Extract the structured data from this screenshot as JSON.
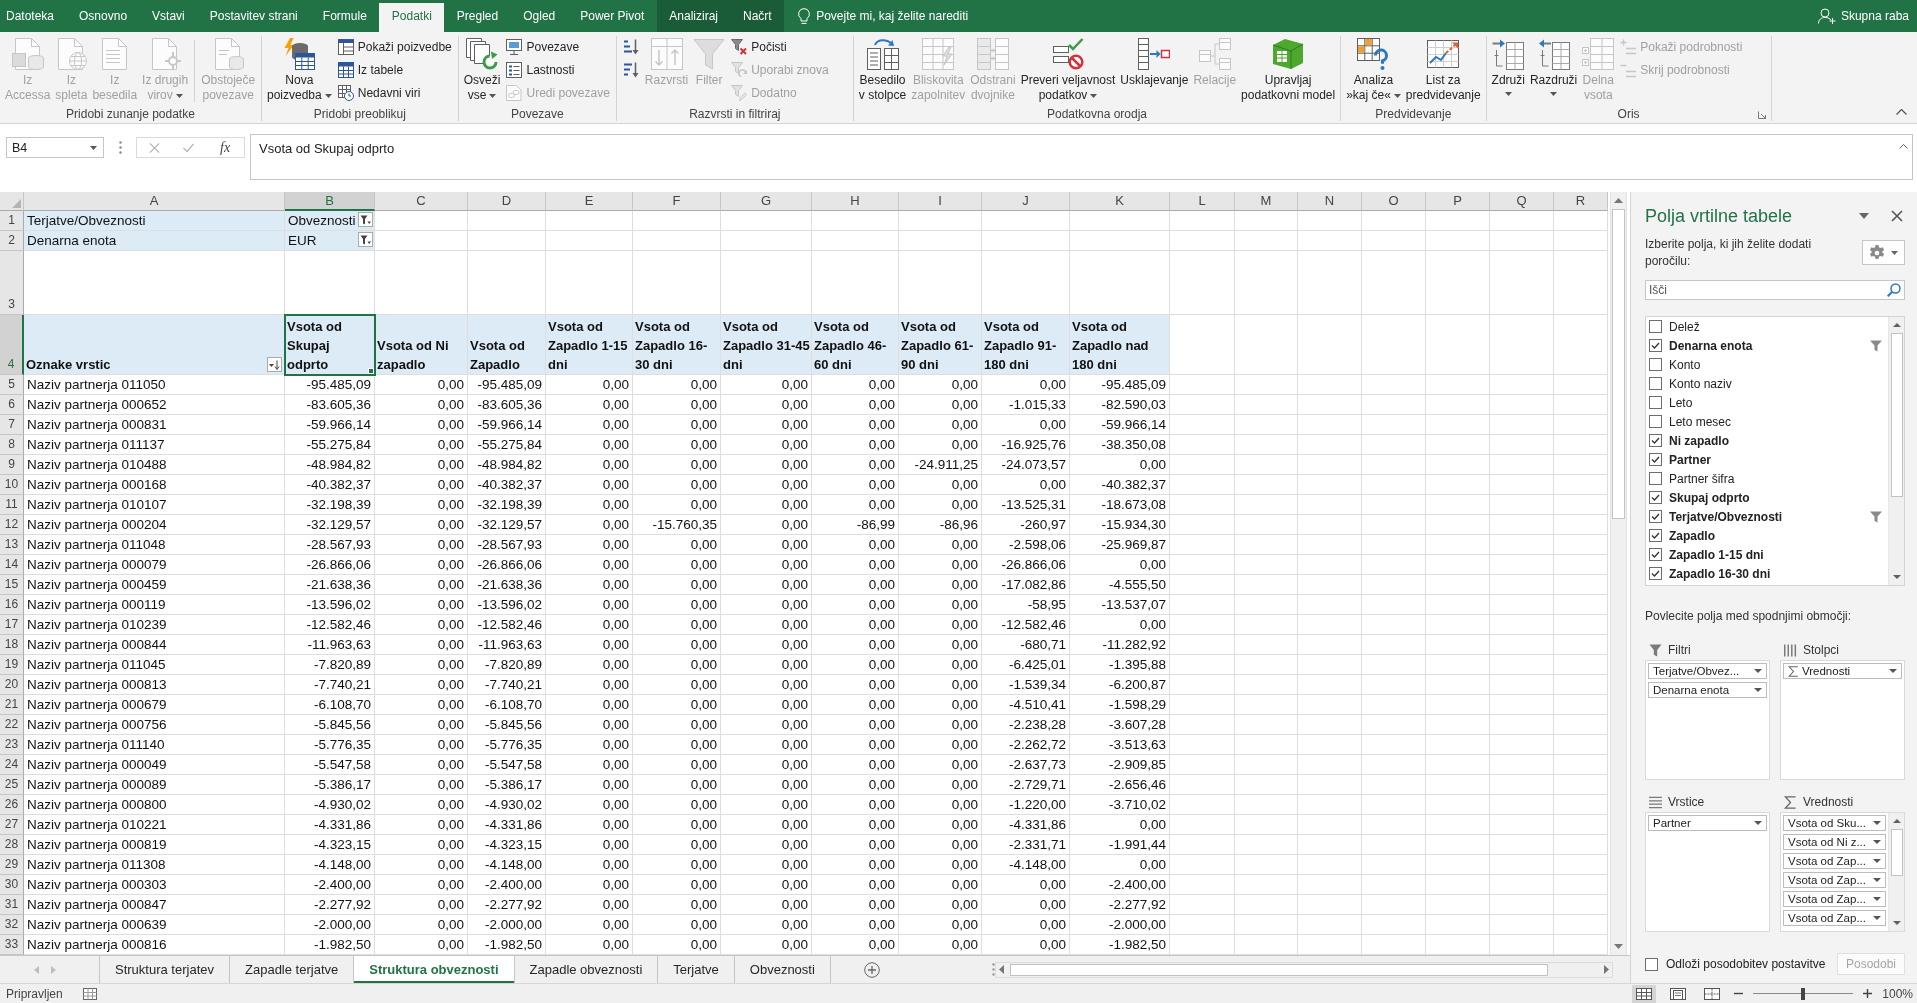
{
  "ribbon_tabs": [
    {
      "label": "Datoteka",
      "kind": "normal",
      "selected": false
    },
    {
      "label": "Osnovno",
      "kind": "normal",
      "selected": false
    },
    {
      "label": "Vstavi",
      "kind": "normal",
      "selected": false
    },
    {
      "label": "Postavitev strani",
      "kind": "normal",
      "selected": false
    },
    {
      "label": "Formule",
      "kind": "normal",
      "selected": false
    },
    {
      "label": "Podatki",
      "kind": "normal",
      "selected": true
    },
    {
      "label": "Pregled",
      "kind": "normal",
      "selected": false
    },
    {
      "label": "Ogled",
      "kind": "normal",
      "selected": false
    },
    {
      "label": "Power Pivot",
      "kind": "normal",
      "selected": false
    },
    {
      "label": "Analiziraj",
      "kind": "contextual",
      "selected": false
    },
    {
      "label": "Načrt",
      "kind": "contextual",
      "selected": false
    }
  ],
  "tell_me": {
    "placeholder": "Povejte mi, kaj želite narediti"
  },
  "share": "Skupna raba",
  "ribbon": {
    "groups": [
      {
        "label": "Pridobi zunanje podatke",
        "items": [
          {
            "kind": "large",
            "label": "Iz\nAccessa",
            "disabled": true,
            "dropdown": false
          },
          {
            "kind": "large",
            "label": "Iz\nspleta",
            "disabled": true,
            "dropdown": false
          },
          {
            "kind": "large",
            "label": "Iz\nbesedila",
            "disabled": true,
            "dropdown": false
          },
          {
            "kind": "large",
            "label": "Iz drugih\nvirov",
            "disabled": true,
            "dropdown": true
          },
          {
            "kind": "large",
            "label": "Obstoječe\npovezave",
            "disabled": true,
            "dropdown": false
          }
        ]
      },
      {
        "label": "Pridobi preoblikuj",
        "items": [
          {
            "kind": "large",
            "label": "Nova\npoizvedba",
            "disabled": false,
            "dropdown": true
          },
          {
            "kind": "stack",
            "buttons": [
              {
                "label": "Pokaži poizvedbe",
                "disabled": false
              },
              {
                "label": "Iz tabele",
                "disabled": false
              },
              {
                "label": "Nedavni viri",
                "disabled": false
              }
            ]
          }
        ]
      },
      {
        "label": "Povezave",
        "items": [
          {
            "kind": "large",
            "label": "Osveži\nvse",
            "disabled": false,
            "dropdown": true
          },
          {
            "kind": "stack",
            "buttons": [
              {
                "label": "Povezave",
                "disabled": false
              },
              {
                "label": "Lastnosti",
                "disabled": false
              },
              {
                "label": "Uredi povezave",
                "disabled": true
              }
            ]
          }
        ]
      },
      {
        "label": "Razvrsti in filtriraj",
        "items": [
          {
            "kind": "stack",
            "buttons": [
              {
                "disabled": false
              },
              {
                "disabled": false
              }
            ]
          },
          {
            "kind": "large",
            "label": "Razvrsti",
            "disabled": true,
            "dropdown": false
          },
          {
            "kind": "large",
            "label": "Filter",
            "disabled": true,
            "dropdown": false
          },
          {
            "kind": "stack",
            "buttons": [
              {
                "label": "Počisti",
                "disabled": false
              },
              {
                "label": "Uporabi znova",
                "disabled": true
              },
              {
                "label": "Dodatno",
                "disabled": true
              }
            ]
          }
        ]
      },
      {
        "label": "Podatkovna orodja",
        "items": [
          {
            "kind": "large",
            "label": "Besedilo\nv stolpce",
            "disabled": false,
            "dropdown": false
          },
          {
            "kind": "large",
            "label": "Bliskovita\nzapolnitev",
            "disabled": true,
            "dropdown": false
          },
          {
            "kind": "large",
            "label": "Odstrani\ndvojnike",
            "disabled": true,
            "dropdown": false
          },
          {
            "kind": "large",
            "label": "Preveri veljavnost\npodatkov",
            "disabled": false,
            "dropdown": true
          },
          {
            "kind": "large",
            "label": "Usklajevanje",
            "disabled": false,
            "dropdown": false
          },
          {
            "kind": "large",
            "label": "Relacije",
            "disabled": true,
            "dropdown": false
          },
          {
            "kind": "large",
            "label": "Upravljaj\npodatkovni model",
            "disabled": false,
            "dropdown": false
          }
        ]
      },
      {
        "label": "Predvidevanje",
        "items": [
          {
            "kind": "large",
            "label": "Analiza\n»kaj če«",
            "disabled": false,
            "dropdown": true
          },
          {
            "kind": "large",
            "label": "List za\npredvidevanje",
            "disabled": false,
            "dropdown": false
          }
        ]
      },
      {
        "label": "Oris",
        "items": [
          {
            "kind": "large",
            "label": "Združi",
            "disabled": false,
            "dropdown": true
          },
          {
            "kind": "large",
            "label": "Razdruži",
            "disabled": false,
            "dropdown": true
          },
          {
            "kind": "large",
            "label": "Delna\nvsota",
            "disabled": true,
            "dropdown": false
          },
          {
            "kind": "stack",
            "buttons": [
              {
                "label": "Pokaži podrobnosti",
                "disabled": true
              },
              {
                "label": "Skrij podrobnosti",
                "disabled": true
              }
            ]
          }
        ]
      }
    ]
  },
  "formula_bar": {
    "name_box": "B4",
    "insert_function": "fx",
    "formula": "Vsota od Skupaj odprto"
  },
  "sheet": {
    "columns": [
      {
        "label": "A",
        "selected": false
      },
      {
        "label": "B",
        "selected": true
      },
      {
        "label": "C",
        "selected": false
      },
      {
        "label": "D",
        "selected": false
      },
      {
        "label": "E",
        "selected": false
      },
      {
        "label": "F",
        "selected": false
      },
      {
        "label": "G",
        "selected": false
      },
      {
        "label": "H",
        "selected": false
      },
      {
        "label": "I",
        "selected": false
      },
      {
        "label": "J",
        "selected": false
      },
      {
        "label": "K",
        "selected": false
      },
      {
        "label": "L",
        "selected": false
      },
      {
        "label": "M",
        "selected": false
      },
      {
        "label": "N",
        "selected": false
      },
      {
        "label": "O",
        "selected": false
      },
      {
        "label": "P",
        "selected": false
      },
      {
        "label": "Q",
        "selected": false
      },
      {
        "label": "R",
        "selected": false
      }
    ],
    "rows": [
      {
        "number": "1",
        "selected": false,
        "kind": "filter",
        "label": "Terjatve/Obveznosti",
        "value": "Obveznosti"
      },
      {
        "number": "2",
        "selected": false,
        "kind": "filter",
        "label": "Denarna enota",
        "value": "EUR"
      },
      {
        "number": "3",
        "selected": false,
        "kind": "blank"
      },
      {
        "number": "4",
        "selected": true,
        "kind": "header",
        "label": "Oznake vrstic",
        "values": [
          "Vsota od\nSkupaj\nodprto",
          "Vsota od Ni\nzapadlo",
          "Vsota od\nZapadlo",
          "Vsota od\nZapadlo 1-15\ndni",
          "Vsota od\nZapadlo 16-\n30 dni",
          "Vsota od\nZapadlo 31-45\ndni",
          "Vsota od\nZapadlo 46-\n60 dni",
          "Vsota od\nZapadlo 61-\n90 dni",
          "Vsota od\nZapadlo 91-\n180 dni",
          "Vsota od\nZapadlo nad\n180 dni"
        ]
      },
      {
        "number": "5",
        "selected": false,
        "kind": "data",
        "label": "Naziv partnerja 011050",
        "values": [
          "-95.485,09",
          "0,00",
          "-95.485,09",
          "0,00",
          "0,00",
          "0,00",
          "0,00",
          "0,00",
          "0,00",
          "-95.485,09"
        ]
      },
      {
        "number": "6",
        "selected": false,
        "kind": "data",
        "label": "Naziv partnerja 000652",
        "values": [
          "-83.605,36",
          "0,00",
          "-83.605,36",
          "0,00",
          "0,00",
          "0,00",
          "0,00",
          "0,00",
          "-1.015,33",
          "-82.590,03"
        ]
      },
      {
        "number": "7",
        "selected": false,
        "kind": "data",
        "label": "Naziv partnerja 000831",
        "values": [
          "-59.966,14",
          "0,00",
          "-59.966,14",
          "0,00",
          "0,00",
          "0,00",
          "0,00",
          "0,00",
          "0,00",
          "-59.966,14"
        ]
      },
      {
        "number": "8",
        "selected": false,
        "kind": "data",
        "label": "Naziv partnerja 011137",
        "values": [
          "-55.275,84",
          "0,00",
          "-55.275,84",
          "0,00",
          "0,00",
          "0,00",
          "0,00",
          "0,00",
          "-16.925,76",
          "-38.350,08"
        ]
      },
      {
        "number": "9",
        "selected": false,
        "kind": "data",
        "label": "Naziv partnerja 010488",
        "values": [
          "-48.984,82",
          "0,00",
          "-48.984,82",
          "0,00",
          "0,00",
          "0,00",
          "0,00",
          "-24.911,25",
          "-24.073,57",
          "0,00"
        ]
      },
      {
        "number": "10",
        "selected": false,
        "kind": "data",
        "label": "Naziv partnerja 000168",
        "values": [
          "-40.382,37",
          "0,00",
          "-40.382,37",
          "0,00",
          "0,00",
          "0,00",
          "0,00",
          "0,00",
          "0,00",
          "-40.382,37"
        ]
      },
      {
        "number": "11",
        "selected": false,
        "kind": "data",
        "label": "Naziv partnerja 010107",
        "values": [
          "-32.198,39",
          "0,00",
          "-32.198,39",
          "0,00",
          "0,00",
          "0,00",
          "0,00",
          "0,00",
          "-13.525,31",
          "-18.673,08"
        ]
      },
      {
        "number": "12",
        "selected": false,
        "kind": "data",
        "label": "Naziv partnerja 000204",
        "values": [
          "-32.129,57",
          "0,00",
          "-32.129,57",
          "0,00",
          "-15.760,35",
          "0,00",
          "-86,99",
          "-86,96",
          "-260,97",
          "-15.934,30"
        ]
      },
      {
        "number": "13",
        "selected": false,
        "kind": "data",
        "label": "Naziv partnerja 011048",
        "values": [
          "-28.567,93",
          "0,00",
          "-28.567,93",
          "0,00",
          "0,00",
          "0,00",
          "0,00",
          "0,00",
          "-2.598,06",
          "-25.969,87"
        ]
      },
      {
        "number": "14",
        "selected": false,
        "kind": "data",
        "label": "Naziv partnerja 000079",
        "values": [
          "-26.866,06",
          "0,00",
          "-26.866,06",
          "0,00",
          "0,00",
          "0,00",
          "0,00",
          "0,00",
          "-26.866,06",
          "0,00"
        ]
      },
      {
        "number": "15",
        "selected": false,
        "kind": "data",
        "label": "Naziv partnerja 000459",
        "values": [
          "-21.638,36",
          "0,00",
          "-21.638,36",
          "0,00",
          "0,00",
          "0,00",
          "0,00",
          "0,00",
          "-17.082,86",
          "-4.555,50"
        ]
      },
      {
        "number": "16",
        "selected": false,
        "kind": "data",
        "label": "Naziv partnerja 000119",
        "values": [
          "-13.596,02",
          "0,00",
          "-13.596,02",
          "0,00",
          "0,00",
          "0,00",
          "0,00",
          "0,00",
          "-58,95",
          "-13.537,07"
        ]
      },
      {
        "number": "17",
        "selected": false,
        "kind": "data",
        "label": "Naziv partnerja 010239",
        "values": [
          "-12.582,46",
          "0,00",
          "-12.582,46",
          "0,00",
          "0,00",
          "0,00",
          "0,00",
          "0,00",
          "-12.582,46",
          "0,00"
        ]
      },
      {
        "number": "18",
        "selected": false,
        "kind": "data",
        "label": "Naziv partnerja 000844",
        "values": [
          "-11.963,63",
          "0,00",
          "-11.963,63",
          "0,00",
          "0,00",
          "0,00",
          "0,00",
          "0,00",
          "-680,71",
          "-11.282,92"
        ]
      },
      {
        "number": "19",
        "selected": false,
        "kind": "data",
        "label": "Naziv partnerja 011045",
        "values": [
          "-7.820,89",
          "0,00",
          "-7.820,89",
          "0,00",
          "0,00",
          "0,00",
          "0,00",
          "0,00",
          "-6.425,01",
          "-1.395,88"
        ]
      },
      {
        "number": "20",
        "selected": false,
        "kind": "data",
        "label": "Naziv partnerja 000813",
        "values": [
          "-7.740,21",
          "0,00",
          "-7.740,21",
          "0,00",
          "0,00",
          "0,00",
          "0,00",
          "0,00",
          "-1.539,34",
          "-6.200,87"
        ]
      },
      {
        "number": "21",
        "selected": false,
        "kind": "data",
        "label": "Naziv partnerja 000679",
        "values": [
          "-6.108,70",
          "0,00",
          "-6.108,70",
          "0,00",
          "0,00",
          "0,00",
          "0,00",
          "0,00",
          "-4.510,41",
          "-1.598,29"
        ]
      },
      {
        "number": "22",
        "selected": false,
        "kind": "data",
        "label": "Naziv partnerja 000756",
        "values": [
          "-5.845,56",
          "0,00",
          "-5.845,56",
          "0,00",
          "0,00",
          "0,00",
          "0,00",
          "0,00",
          "-2.238,28",
          "-3.607,28"
        ]
      },
      {
        "number": "23",
        "selected": false,
        "kind": "data",
        "label": "Naziv partnerja 011140",
        "values": [
          "-5.776,35",
          "0,00",
          "-5.776,35",
          "0,00",
          "0,00",
          "0,00",
          "0,00",
          "0,00",
          "-2.262,72",
          "-3.513,63"
        ]
      },
      {
        "number": "24",
        "selected": false,
        "kind": "data",
        "label": "Naziv partnerja 000049",
        "values": [
          "-5.547,58",
          "0,00",
          "-5.547,58",
          "0,00",
          "0,00",
          "0,00",
          "0,00",
          "0,00",
          "-2.637,73",
          "-2.909,85"
        ]
      },
      {
        "number": "25",
        "selected": false,
        "kind": "data",
        "label": "Naziv partnerja 000089",
        "values": [
          "-5.386,17",
          "0,00",
          "-5.386,17",
          "0,00",
          "0,00",
          "0,00",
          "0,00",
          "0,00",
          "-2.729,71",
          "-2.656,46"
        ]
      },
      {
        "number": "26",
        "selected": false,
        "kind": "data",
        "label": "Naziv partnerja 000800",
        "values": [
          "-4.930,02",
          "0,00",
          "-4.930,02",
          "0,00",
          "0,00",
          "0,00",
          "0,00",
          "0,00",
          "-1.220,00",
          "-3.710,02"
        ]
      },
      {
        "number": "27",
        "selected": false,
        "kind": "data",
        "label": "Naziv partnerja 010221",
        "values": [
          "-4.331,86",
          "0,00",
          "-4.331,86",
          "0,00",
          "0,00",
          "0,00",
          "0,00",
          "0,00",
          "-4.331,86",
          "0,00"
        ]
      },
      {
        "number": "28",
        "selected": false,
        "kind": "data",
        "label": "Naziv partnerja 000819",
        "values": [
          "-4.323,15",
          "0,00",
          "-4.323,15",
          "0,00",
          "0,00",
          "0,00",
          "0,00",
          "0,00",
          "-2.331,71",
          "-1.991,44"
        ]
      },
      {
        "number": "29",
        "selected": false,
        "kind": "data",
        "label": "Naziv partnerja 011308",
        "values": [
          "-4.148,00",
          "0,00",
          "-4.148,00",
          "0,00",
          "0,00",
          "0,00",
          "0,00",
          "0,00",
          "-4.148,00",
          "0,00"
        ]
      },
      {
        "number": "30",
        "selected": false,
        "kind": "data",
        "label": "Naziv partnerja 000303",
        "values": [
          "-2.400,00",
          "0,00",
          "-2.400,00",
          "0,00",
          "0,00",
          "0,00",
          "0,00",
          "0,00",
          "0,00",
          "-2.400,00"
        ]
      },
      {
        "number": "31",
        "selected": false,
        "kind": "data",
        "label": "Naziv partnerja 000847",
        "values": [
          "-2.277,92",
          "0,00",
          "-2.277,92",
          "0,00",
          "0,00",
          "0,00",
          "0,00",
          "0,00",
          "0,00",
          "-2.277,92"
        ]
      },
      {
        "number": "32",
        "selected": false,
        "kind": "data",
        "label": "Naziv partnerja 000639",
        "values": [
          "-2.000,00",
          "0,00",
          "-2.000,00",
          "0,00",
          "0,00",
          "0,00",
          "0,00",
          "0,00",
          "0,00",
          "-2.000,00"
        ]
      },
      {
        "number": "33",
        "selected": false,
        "kind": "data",
        "label": "Naziv partnerja 000816",
        "values": [
          "-1.982,50",
          "0,00",
          "-1.982,50",
          "0,00",
          "0,00",
          "0,00",
          "0,00",
          "0,00",
          "0,00",
          "-1.982,50"
        ]
      }
    ]
  },
  "sheet_tabs": [
    {
      "label": "Struktura terjatev",
      "selected": false
    },
    {
      "label": "Zapadle terjatve",
      "selected": false
    },
    {
      "label": "Struktura obveznosti",
      "selected": true
    },
    {
      "label": "Zapadle obveznosti",
      "selected": false
    },
    {
      "label": "Terjatve",
      "selected": false
    },
    {
      "label": "Obveznosti",
      "selected": false
    }
  ],
  "pivot_panel": {
    "title": "Polja vrtilne tabele",
    "instruction": "Izberite polja, ki jih želite dodati poročilu:",
    "search": {
      "placeholder": "Išči"
    },
    "fields": [
      {
        "label": "Delež",
        "checked": false,
        "filtered": false
      },
      {
        "label": "Denarna enota",
        "checked": true,
        "filtered": true
      },
      {
        "label": "Konto",
        "checked": false,
        "filtered": false
      },
      {
        "label": "Konto naziv",
        "checked": false,
        "filtered": false
      },
      {
        "label": "Leto",
        "checked": false,
        "filtered": false
      },
      {
        "label": "Leto mesec",
        "checked": false,
        "filtered": false
      },
      {
        "label": "Ni zapadlo",
        "checked": true,
        "filtered": false
      },
      {
        "label": "Partner",
        "checked": true,
        "filtered": false
      },
      {
        "label": "Partner šifra",
        "checked": false,
        "filtered": false
      },
      {
        "label": "Skupaj odprto",
        "checked": true,
        "filtered": false
      },
      {
        "label": "Terjatve/Obveznosti",
        "checked": true,
        "filtered": true
      },
      {
        "label": "Zapadlo",
        "checked": true,
        "filtered": false
      },
      {
        "label": "Zapadlo 1-15 dni",
        "checked": true,
        "filtered": false
      },
      {
        "label": "Zapadlo 16-30 dni",
        "checked": true,
        "filtered": false
      }
    ],
    "drag_hint": "Povlecite polja med spodnjimi območji:",
    "areas": [
      {
        "kind": "filters",
        "label": "Filtri",
        "items": [
          {
            "kind": "field",
            "label": "Terjatve/Obvez..."
          },
          {
            "kind": "field",
            "label": "Denarna enota"
          }
        ]
      },
      {
        "kind": "columns",
        "label": "Stolpci",
        "items": [
          {
            "kind": "values",
            "label": "Vrednosti"
          }
        ]
      },
      {
        "kind": "rows",
        "label": "Vrstice",
        "items": [
          {
            "kind": "field",
            "label": "Partner"
          }
        ]
      },
      {
        "kind": "values",
        "label": "Vrednosti",
        "items": [
          {
            "kind": "field",
            "label": "Vsota od Sku..."
          },
          {
            "kind": "field",
            "label": "Vsota od Ni z..."
          },
          {
            "kind": "field",
            "label": "Vsota od Zap..."
          },
          {
            "kind": "field",
            "label": "Vsota od Zap..."
          },
          {
            "kind": "field",
            "label": "Vsota od Zap..."
          },
          {
            "kind": "field",
            "label": "Vsota od Zap..."
          }
        ]
      }
    ],
    "defer": {
      "label": "Odloži posodobitev postavitve",
      "checked": false
    },
    "update_button": {
      "label": "Posodobi",
      "disabled": true
    }
  },
  "status_bar": {
    "text": "Pripravljen",
    "views": [
      {
        "selected": true
      },
      {
        "selected": false
      },
      {
        "selected": false
      }
    ],
    "zoom_slider": {
      "level": 0.5
    },
    "zoom": "100%"
  }
}
